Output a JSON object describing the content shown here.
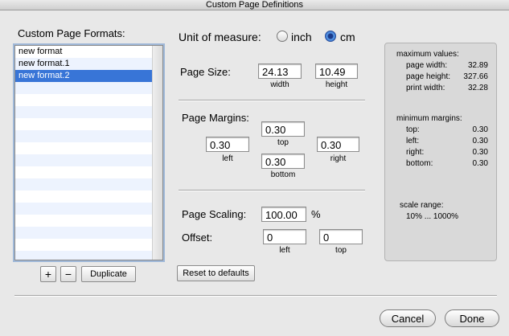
{
  "window": {
    "title": "Custom Page Definitions"
  },
  "formats": {
    "heading": "Custom Page Formats:",
    "items": [
      "new format",
      "new format.1",
      "new format.2"
    ],
    "selected_index": 2,
    "add_label": "+",
    "remove_label": "−",
    "duplicate_label": "Duplicate"
  },
  "unit": {
    "label": "Unit of measure:",
    "options": [
      "inch",
      "cm"
    ],
    "selected": "cm"
  },
  "page_size": {
    "label": "Page Size:",
    "width_value": "24.13",
    "height_value": "10.49",
    "width_caption": "width",
    "height_caption": "height"
  },
  "margins": {
    "label": "Page Margins:",
    "top_value": "0.30",
    "left_value": "0.30",
    "right_value": "0.30",
    "bottom_value": "0.30",
    "top_caption": "top",
    "left_caption": "left",
    "right_caption": "right",
    "bottom_caption": "bottom"
  },
  "scaling": {
    "label": "Page Scaling:",
    "value": "100.00",
    "unit": "%"
  },
  "offset": {
    "label": "Offset:",
    "left_value": "0",
    "top_value": "0",
    "left_caption": "left",
    "top_caption": "top"
  },
  "reset_label": "Reset to defaults",
  "info": {
    "max_heading": "maximum values:",
    "max_rows": [
      {
        "label": "page width:",
        "value": "32.89"
      },
      {
        "label": "page height:",
        "value": "327.66"
      },
      {
        "label": "print width:",
        "value": "32.28"
      }
    ],
    "min_heading": "minimum margins:",
    "min_rows": [
      {
        "label": "top:",
        "value": "0.30"
      },
      {
        "label": "left:",
        "value": "0.30"
      },
      {
        "label": "right:",
        "value": "0.30"
      },
      {
        "label": "bottom:",
        "value": "0.30"
      }
    ],
    "scale_heading": "scale range:",
    "scale_value": "10% ... 1000%"
  },
  "footer": {
    "cancel_label": "Cancel",
    "done_label": "Done"
  },
  "colors": {
    "selection": "#3875d7",
    "stripe": "#edf3fe",
    "panel": "#d9d9d9"
  }
}
